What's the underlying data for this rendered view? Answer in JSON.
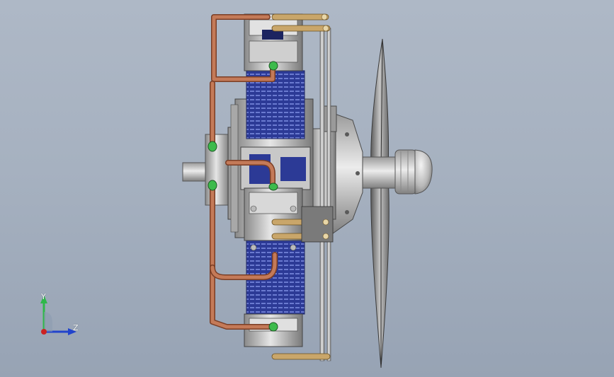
{
  "window": {
    "background_top": "#aeb8c6",
    "background_bottom": "#97a3b4"
  },
  "model": {
    "name_icon": "radial-engine-icon",
    "components": [
      "propeller-icon",
      "spinner-icon",
      "crankcase-icon",
      "cylinder-icon",
      "copper-pipe-icon",
      "rocker-arm-icon",
      "push-rod-icon",
      "output-shaft-icon"
    ],
    "colors": {
      "copper": "#b8704f",
      "cylinder_blue": "#2c3a96",
      "metal_light": "#d4d4d4",
      "metal_dark": "#6e6e6e",
      "brass": "#c9a66a",
      "fitting_green": "#3dbb4c"
    }
  },
  "triad": {
    "y_label": "Y",
    "z_label": "Z",
    "y_color": "#2fb84a",
    "z_color": "#2244cc",
    "x_color": "#cc2222"
  }
}
